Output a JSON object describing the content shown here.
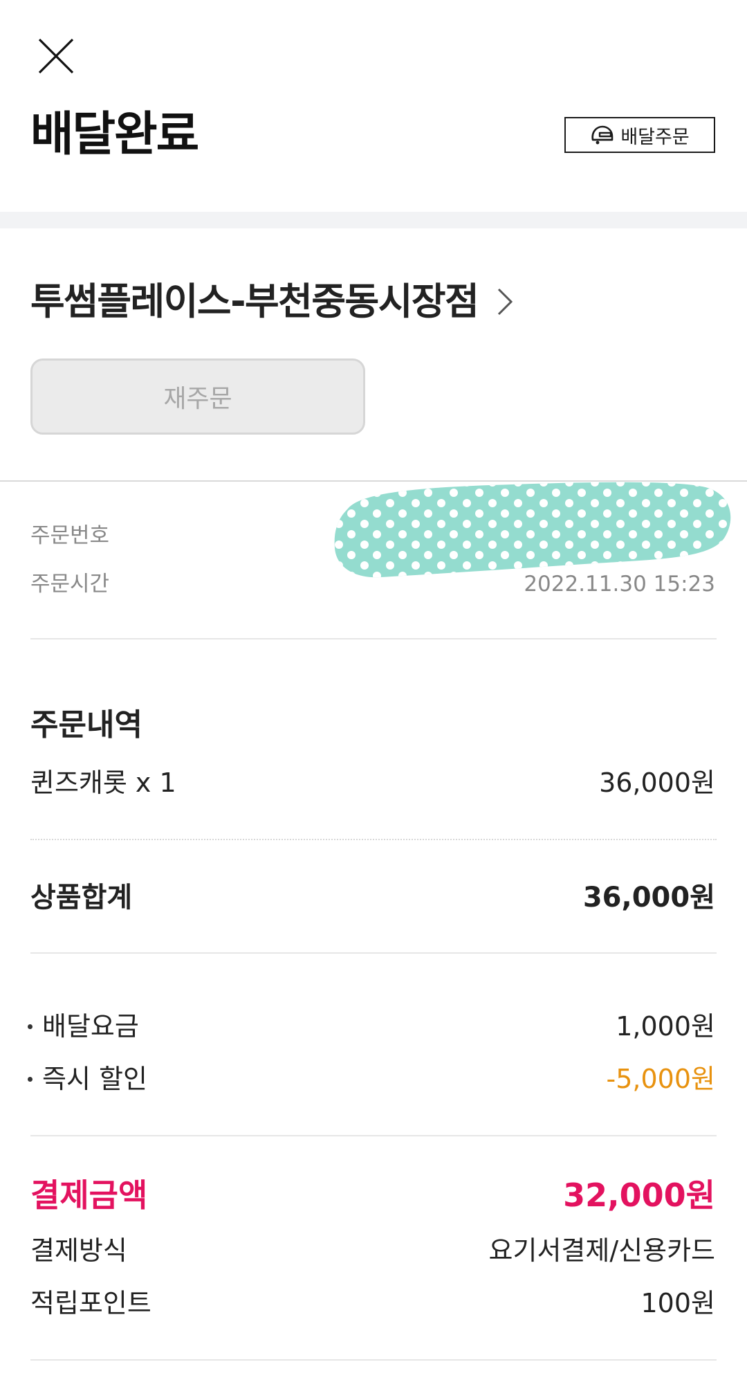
{
  "header": {
    "title": "배달완료",
    "badge_label": "배달주문"
  },
  "store": {
    "name": "투썸플레이스-부천중동시장점",
    "reorder_label": "재주문"
  },
  "order_info": {
    "number_label": "주문번호",
    "time_label": "주문시간",
    "time_value": "2022.11.30 15:23"
  },
  "order_details": {
    "title": "주문내역",
    "items": [
      {
        "name": "퀸즈캐롯 x 1",
        "price": "36,000원"
      }
    ],
    "subtotal_label": "상품합계",
    "subtotal_value": "36,000원"
  },
  "fees": {
    "delivery_label": "배달요금",
    "delivery_value": "1,000원",
    "discount_label": "즉시 할인",
    "discount_value": "-5,000원"
  },
  "payment": {
    "total_label": "결제금액",
    "total_value": "32,000원",
    "method_label": "결제방식",
    "method_value": "요기서결제/신용카드",
    "points_label": "적립포인트",
    "points_value": "100원"
  },
  "colors": {
    "total_accent": "#e3125f",
    "discount_accent": "#e8920f",
    "redaction_fill": "#94dccf"
  },
  "icons": {
    "close": "close-icon",
    "delivery": "delivery-helmet-icon",
    "chevron": "chevron-right-icon"
  }
}
